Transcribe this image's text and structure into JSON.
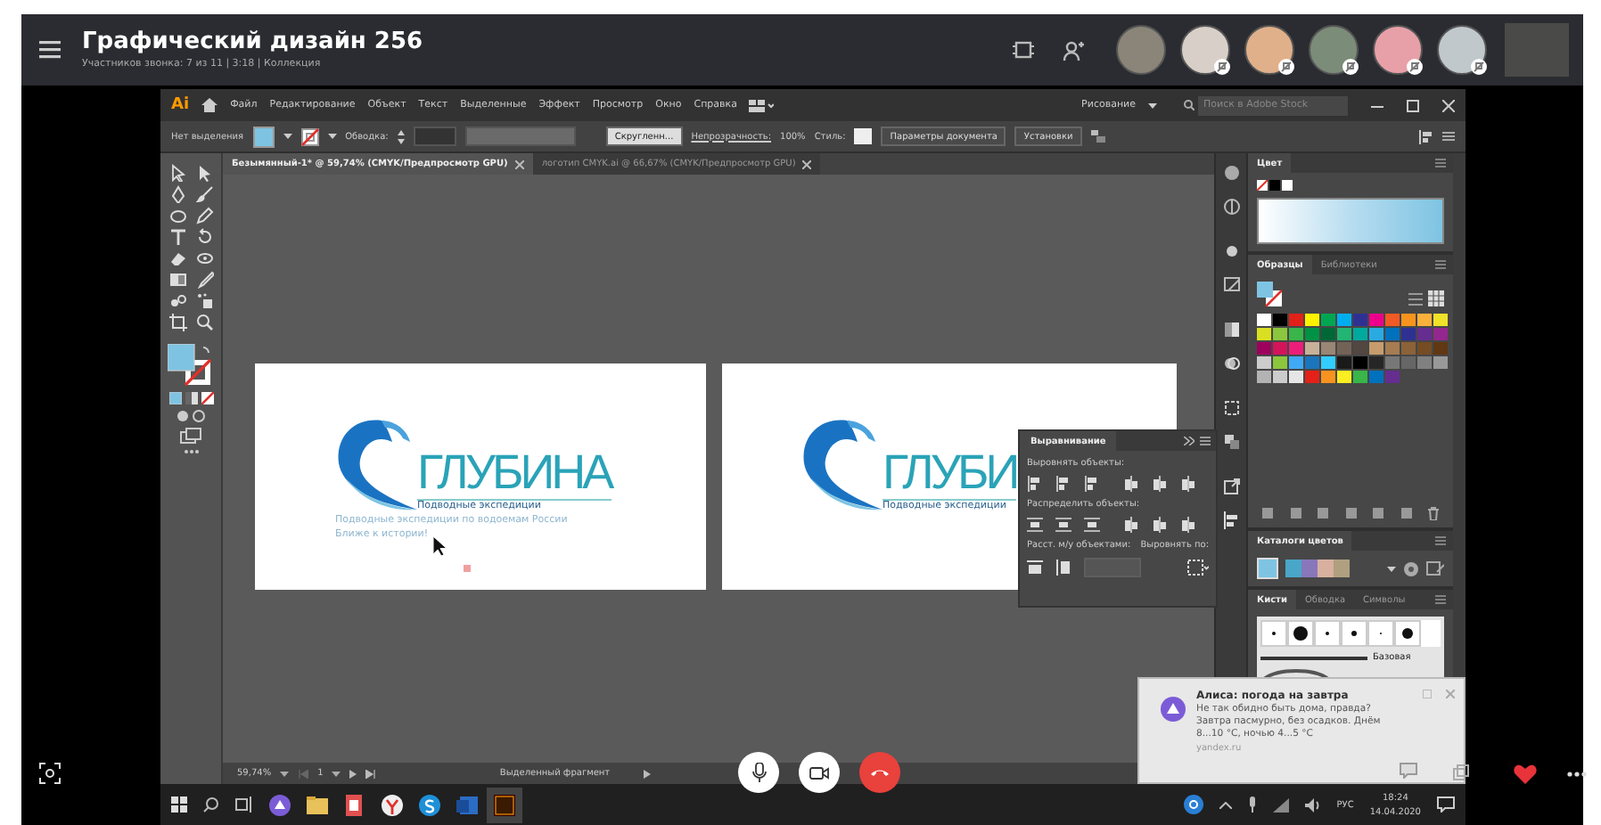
{
  "call": {
    "title": "Графический дизайн 256",
    "subtitle": "Участников звонка: 7 из 11 | 3:18 | Коллекция"
  },
  "illustrator": {
    "app_logo": "Ai",
    "menu": [
      "Файл",
      "Редактирование",
      "Объект",
      "Текст",
      "Выделенные",
      "Эффект",
      "Просмотр",
      "Окно",
      "Справка"
    ],
    "workspace": "Рисование",
    "search": {
      "placeholder": "Поиск в Adobe Stock"
    },
    "control_bar": {
      "selection": "Нет выделения",
      "stroke_label": "Обводка:",
      "brush": "Скругленн...",
      "opacity_label": "Непрозрачность:",
      "opacity": "100%",
      "style_label": "Стиль:",
      "buttons": [
        "Параметры документа",
        "Установки"
      ]
    },
    "document_tabs": [
      {
        "label": "Безымянный-1* @ 59,74% (CMYK/Предпросмотр GPU)",
        "selected": true
      },
      {
        "label": "логотип CMYK.ai @ 66,67% (CMYK/Предпросмотр GPU)",
        "selected": false
      }
    ],
    "artboards": [
      {
        "brand": "ГЛУБИНА",
        "tagline": "Подводные экспедиции",
        "lines": [
          "Подводные экспедиции по водоемам России",
          "Ближе к истории!"
        ]
      },
      {
        "brand": "ГЛУБИ",
        "tagline": "Подводные экспедиции"
      }
    ],
    "align_panel": {
      "title": "Выравнивание",
      "sections": [
        "Выровнять объекты:",
        "Распределить объекты:"
      ],
      "spacing_label": "Расст. м/у объектами:",
      "align_to_label": "Выровнять по:"
    },
    "panels": {
      "color": {
        "title": "Цвет"
      },
      "swatches": {
        "tabs": [
          {
            "label": "Образцы",
            "selected": true
          },
          {
            "label": "Библиотеки",
            "selected": false
          }
        ]
      },
      "color_guide": {
        "title": "Каталоги цветов"
      },
      "brushes": {
        "tabs": [
          {
            "label": "Кисти",
            "selected": true
          },
          {
            "label": "Обводка",
            "selected": false
          },
          {
            "label": "Символы",
            "selected": false
          }
        ],
        "stroke_name": "Базовая"
      }
    },
    "status_bar": {
      "zoom": "59,74%",
      "artboard": "1",
      "tool": "Выделенный фрагмент"
    }
  },
  "notification": {
    "title": "Алиса: погода на завтра",
    "body": "Не так обидно быть дома, правда? Завтра пасмурно, без осадков. Днём 8...10 °C, ночью 4...5 °C",
    "source": "yandex.ru"
  },
  "taskbar": {
    "language": "РУС",
    "time": "18:24",
    "date": "14.04.2020"
  }
}
